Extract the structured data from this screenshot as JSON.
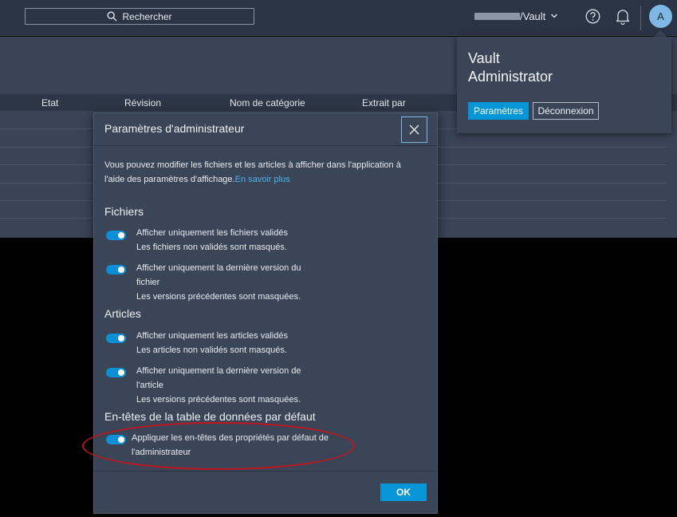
{
  "topbar": {
    "search_placeholder": "Rechercher",
    "vault_label": "/Vault",
    "avatar_initial": "A"
  },
  "table": {
    "columns": [
      "Etat",
      "Révision",
      "Nom de catégorie",
      "Extrait par"
    ]
  },
  "user_popover": {
    "user_name": "Vault\nAdministrator",
    "settings_button": "Paramètres",
    "logout_button": "Déconnexion"
  },
  "dialog": {
    "title": "Paramètres d'administrateur",
    "intro_text": "Vous pouvez modifier les fichiers et les articles à afficher dans l'application à l'aide des paramètres d'affichage.",
    "learn_more_link": "En savoir plus",
    "sections": {
      "files": {
        "title": "Fichiers",
        "options": [
          {
            "label": "Afficher uniquement les fichiers validés",
            "description": "Les fichiers non validés sont masqués.",
            "enabled": true
          },
          {
            "label": "Afficher uniquement la dernière version du fichier",
            "description": "Les versions précédentes sont masquées.",
            "enabled": true
          }
        ]
      },
      "articles": {
        "title": "Articles",
        "options": [
          {
            "label": "Afficher uniquement les articles validés",
            "description": "Les articles non validés sont masqués.",
            "enabled": true
          },
          {
            "label": "Afficher uniquement la dernière version de l'article",
            "description": "Les versions précédentes sont masquées.",
            "enabled": true
          }
        ]
      },
      "headers": {
        "title": "En-têtes de la table de données par défaut",
        "options": [
          {
            "label": "Appliquer les en-têtes des propriétés par défaut de l'administrateur",
            "enabled": true
          }
        ]
      }
    },
    "ok_button": "OK"
  },
  "colors": {
    "accent": "#0696d7",
    "annotation": "#c2141c"
  }
}
